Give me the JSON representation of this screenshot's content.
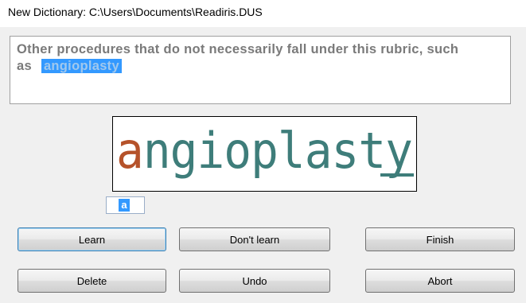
{
  "window": {
    "title": "New Dictionary: C:\\Users\\Documents\\Readiris.DUS"
  },
  "context": {
    "line1": "Other procedures that do not necessarily fall under this rubric, such",
    "line2_prefix": "as",
    "highlighted_word": "angioplasty"
  },
  "glyph_image": {
    "word": "angioplasty",
    "current_char": "a",
    "rest": "ngioplasty",
    "current_char_color": "#b5522a",
    "rest_color": "#3e7d7a"
  },
  "char_field": {
    "value": "a"
  },
  "buttons": {
    "learn": "Learn",
    "dont_learn": "Don't learn",
    "finish": "Finish",
    "delete": "Delete",
    "undo": "Undo",
    "abort": "Abort"
  }
}
